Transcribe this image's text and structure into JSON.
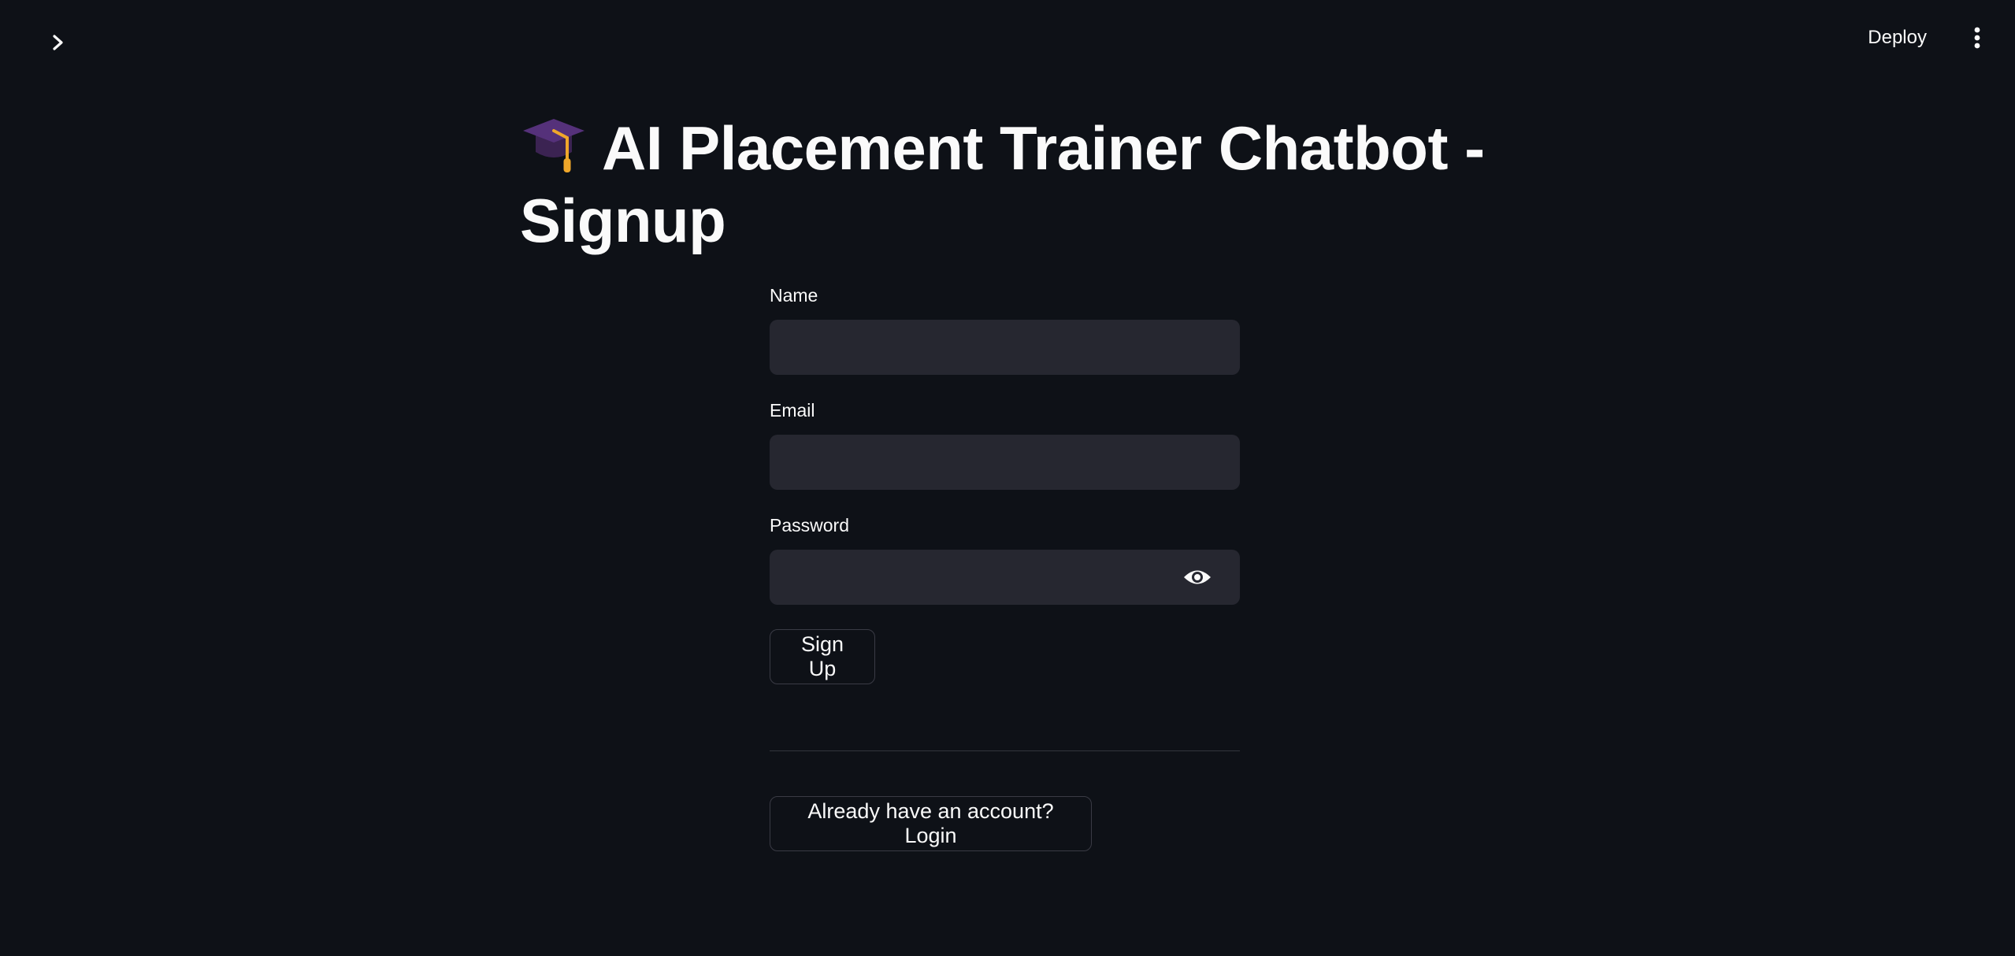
{
  "header": {
    "deploy_label": "Deploy",
    "sidebar_toggle_icon": "chevron-right-icon",
    "menu_icon": "kebab-menu-icon"
  },
  "title": {
    "icon": "graduation-cap-icon",
    "text": "AI Placement Trainer Chatbot - Signup"
  },
  "form": {
    "name": {
      "label": "Name",
      "value": "",
      "placeholder": ""
    },
    "email": {
      "label": "Email",
      "value": "",
      "placeholder": ""
    },
    "password": {
      "label": "Password",
      "value": "",
      "placeholder": "",
      "toggle_icon": "eye-icon"
    },
    "submit_label": "Sign Up"
  },
  "footer": {
    "login_label": "Already have an account? Login"
  },
  "colors": {
    "background": "#0e1117",
    "input_background": "#262730",
    "text": "#fafafa",
    "border": "#3a3b45"
  }
}
